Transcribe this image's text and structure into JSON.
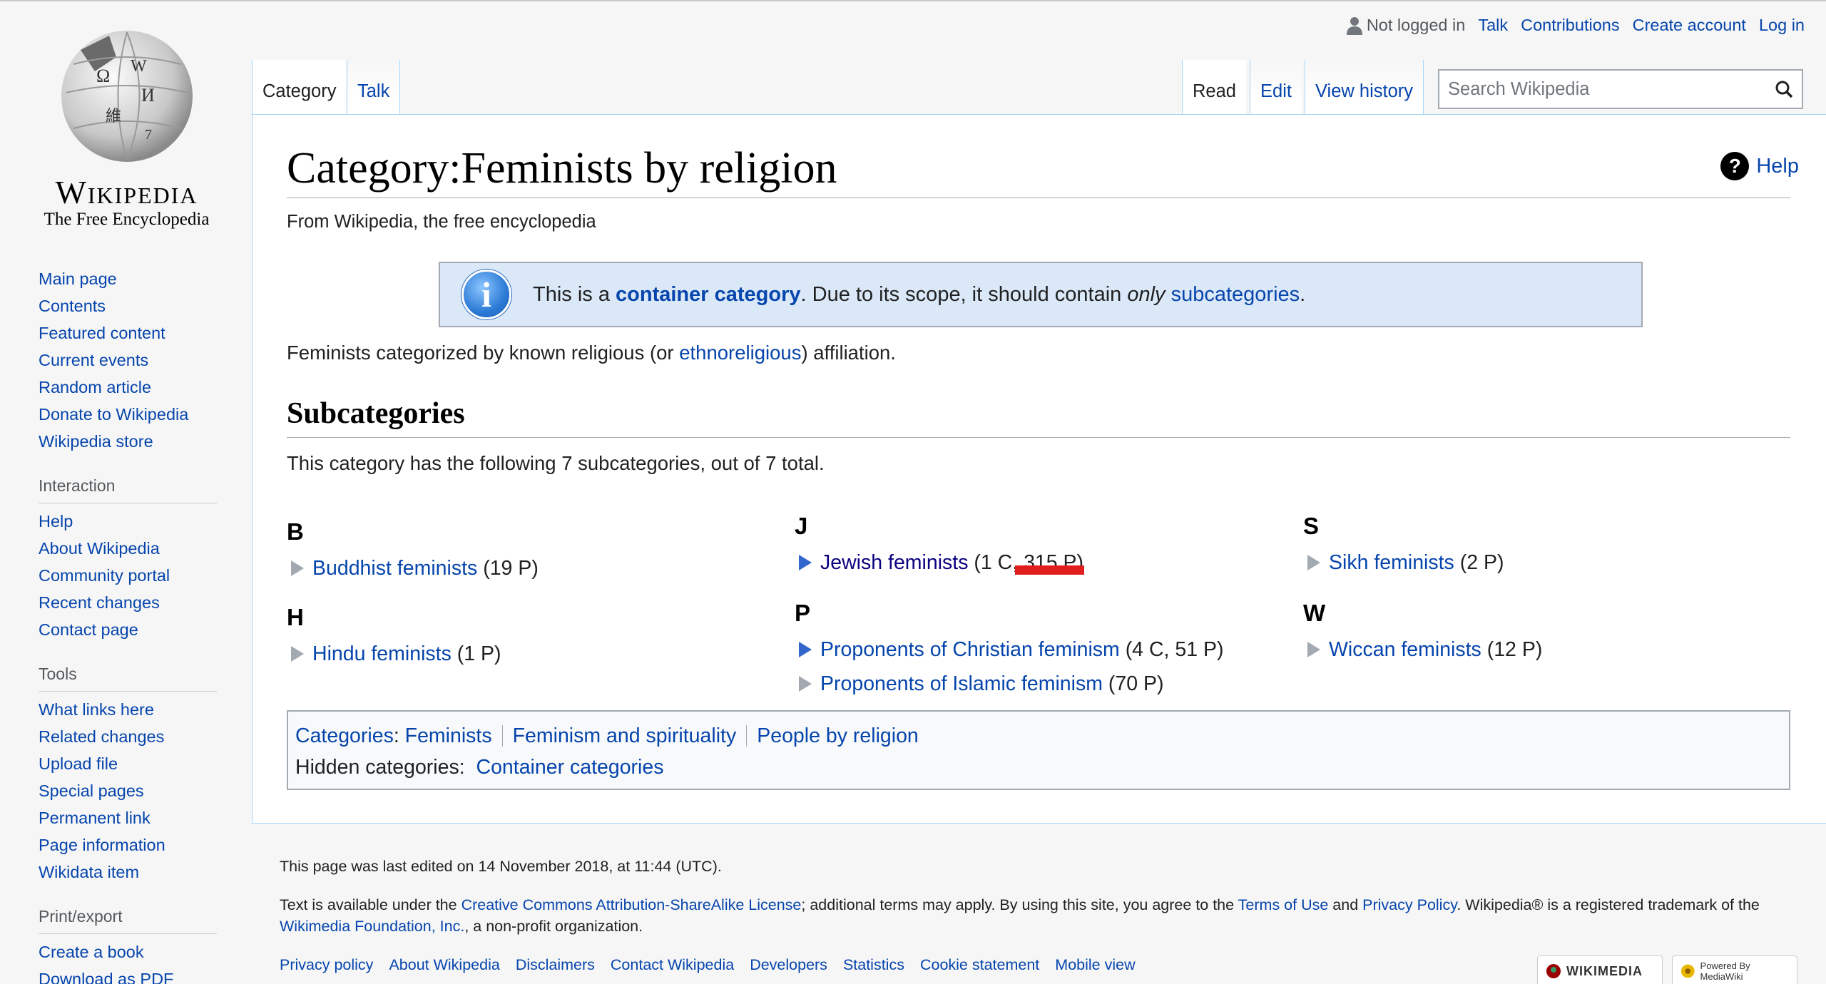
{
  "logo": {
    "wordmark": "Wikipedia",
    "tagline": "The Free Encyclopedia"
  },
  "personal": {
    "not_logged_in": "Not logged in",
    "talk": "Talk",
    "contributions": "Contributions",
    "create_account": "Create account",
    "log_in": "Log in"
  },
  "tabs": {
    "category": "Category",
    "talk": "Talk",
    "read": "Read",
    "edit": "Edit",
    "history": "View history"
  },
  "search": {
    "placeholder": "Search Wikipedia"
  },
  "sidebar": {
    "nav": [
      "Main page",
      "Contents",
      "Featured content",
      "Current events",
      "Random article",
      "Donate to Wikipedia",
      "Wikipedia store"
    ],
    "interaction_heading": "Interaction",
    "interaction": [
      "Help",
      "About Wikipedia",
      "Community portal",
      "Recent changes",
      "Contact page"
    ],
    "tools_heading": "Tools",
    "tools": [
      "What links here",
      "Related changes",
      "Upload file",
      "Special pages",
      "Permanent link",
      "Page information",
      "Wikidata item"
    ],
    "print_heading": "Print/export",
    "print": [
      "Create a book",
      "Download as PDF"
    ]
  },
  "page": {
    "title": "Category:Feminists by religion",
    "help": "Help",
    "from": "From Wikipedia, the free encyclopedia",
    "notice": {
      "pre": "This is a ",
      "link": "container category",
      "mid": ". Due to its scope, it should contain ",
      "em": "only",
      "link2": "subcategories",
      "post": "."
    },
    "desc": {
      "pre": "Feminists categorized by known religious (or ",
      "link": "ethnoreligious",
      "post": ") affiliation."
    },
    "subcat_heading": "Subcategories",
    "subcat_count": "This category has the following 7 subcategories, out of 7 total.",
    "groups": {
      "b": {
        "letter": "B",
        "items": [
          {
            "name": "Buddhist feminists",
            "count": "(19 P)"
          }
        ]
      },
      "h": {
        "letter": "H",
        "items": [
          {
            "name": "Hindu feminists",
            "count": "(1 P)"
          }
        ]
      },
      "j": {
        "letter": "J",
        "items": [
          {
            "name": "Jewish feminists",
            "count": "(1 C, 315 P)"
          }
        ]
      },
      "p": {
        "letter": "P",
        "items": [
          {
            "name": "Proponents of Christian feminism",
            "count": "(4 C, 51 P)"
          },
          {
            "name": "Proponents of Islamic feminism",
            "count": "(70 P)"
          }
        ]
      },
      "s": {
        "letter": "S",
        "items": [
          {
            "name": "Sikh feminists",
            "count": "(2 P)"
          }
        ]
      },
      "w": {
        "letter": "W",
        "items": [
          {
            "name": "Wiccan feminists",
            "count": "(12 P)"
          }
        ]
      }
    },
    "catlinks": {
      "label": "Categories",
      "colon": ":",
      "cats": [
        "Feminists",
        "Feminism and spirituality",
        "People by religion"
      ],
      "hidden_label": "Hidden categories:",
      "hidden": [
        "Container categories"
      ]
    }
  },
  "footer": {
    "last_edited": "This page was last edited on 14 November 2018, at 11:44 (UTC).",
    "license_pre": "Text is available under the ",
    "license_link": "Creative Commons Attribution-ShareAlike License",
    "license_mid": "; additional terms may apply. By using this site, you agree to the ",
    "terms": "Terms of Use",
    "and": " and ",
    "privacy": "Privacy Policy",
    "license_post": ". Wikipedia® is a registered trademark of the ",
    "foundation": "Wikimedia Foundation, Inc.",
    "license_end": ", a non-profit organization.",
    "links": [
      "Privacy policy",
      "About Wikipedia",
      "Disclaimers",
      "Contact Wikipedia",
      "Developers",
      "Statistics",
      "Cookie statement",
      "Mobile view"
    ],
    "badges": {
      "wikimedia": "WIKIMEDIA",
      "mediawiki": "Powered By MediaWiki"
    }
  }
}
